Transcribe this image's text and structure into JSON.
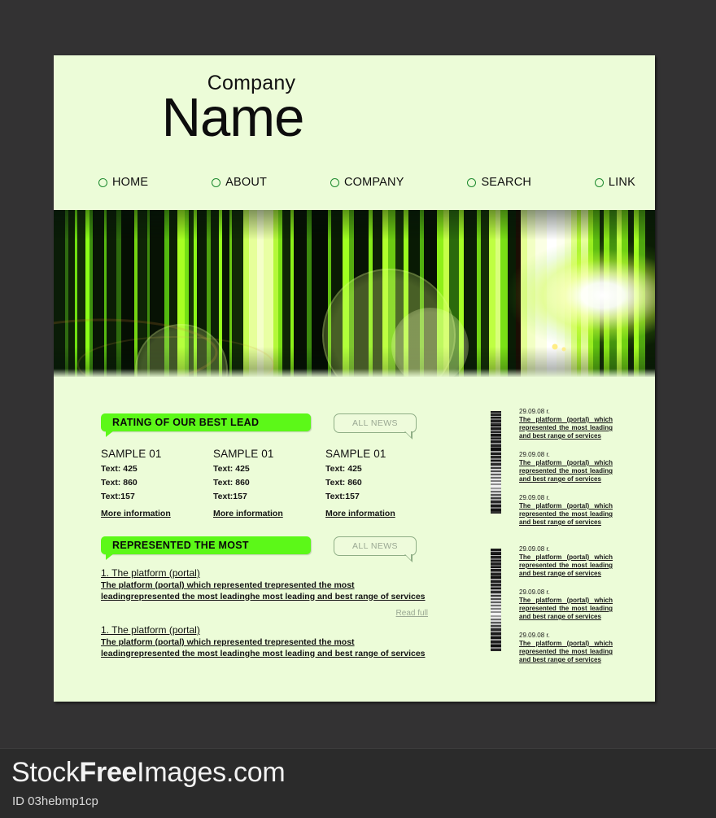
{
  "header": {
    "logo_top": "Company",
    "logo_main": "Name"
  },
  "nav": {
    "bullet_icon": "circle-outline-icon",
    "items": [
      {
        "label": "HOME"
      },
      {
        "label": "ABOUT"
      },
      {
        "label": "COMPANY"
      },
      {
        "label": "SEARCH"
      },
      {
        "label": "LINK"
      }
    ]
  },
  "banner": {
    "alt": "green vertical light streaks abstract banner",
    "accent_color": "#5cf818",
    "dark_color": "#050a03",
    "glow_color": "#ffffff"
  },
  "sections": [
    {
      "title": "RATING OF OUR BEST LEAD",
      "all_news_label": "ALL NEWS"
    },
    {
      "title": "REPRESENTED THE MOST",
      "all_news_label": "ALL NEWS"
    }
  ],
  "samples": [
    {
      "title": "SAMPLE 01",
      "line1": "Text: 425",
      "line2": "Text: 860",
      "line3": "Text:157",
      "more_link": "More information"
    },
    {
      "title": "SAMPLE 01",
      "line1": "Text: 425",
      "line2": "Text: 860",
      "line3": "Text:157",
      "more_link": "More information"
    },
    {
      "title": "SAMPLE 01",
      "line1": "Text: 425",
      "line2": "Text: 860",
      "line3": "Text:157",
      "more_link": "More information"
    }
  ],
  "articles": [
    {
      "title": "1. The platform (portal)",
      "body": "The platform (portal) which represented trepresented the most leadingrepresented the most leadinghe most leading and best range of services",
      "read_full": "Read full"
    },
    {
      "title": "1. The platform (portal)",
      "body": "The platform (portal) which represented trepresented the most leadingrepresented the most leadinghe most leading and best range of services"
    }
  ],
  "news_groups": [
    {
      "strip_icon": "barcode-strip-icon",
      "items": [
        {
          "date": "29.09.08 r.",
          "text": "The platform (portal) which represented the most leading and best range of services"
        },
        {
          "date": "29.09.08 r.",
          "text": "The platform (portal) which represented the most leading and best range of services"
        },
        {
          "date": "29.09.08 r.",
          "text": "The platform (portal) which represented the most leading and best range of services"
        }
      ]
    },
    {
      "strip_icon": "barcode-strip-icon",
      "items": [
        {
          "date": "29.09.08 r.",
          "text": "The platform (portal) which represented the most leading and best range of services"
        },
        {
          "date": "29.09.08 r.",
          "text": "The platform (portal) which represented the most leading and best range of services"
        },
        {
          "date": "29.09.08 r.",
          "text": "The platform (portal) which represented the most leading and best range of services"
        }
      ]
    }
  ],
  "watermark": {
    "title_part1": "Stock",
    "title_part2": "Free",
    "title_part3": "Images.com",
    "id": "ID 03hebmp1cp"
  }
}
